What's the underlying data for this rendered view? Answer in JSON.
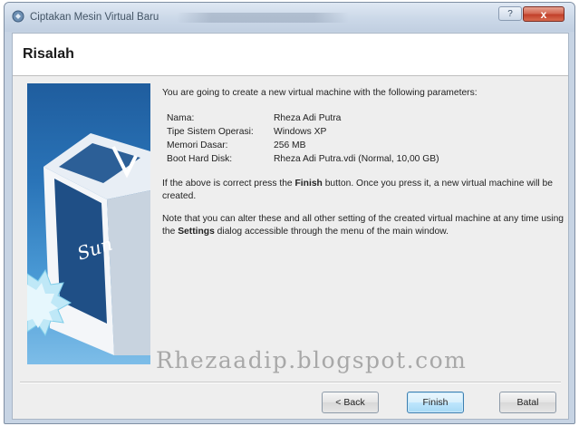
{
  "window": {
    "title": "Ciptakan Mesin Virtual Baru",
    "help_label": "?",
    "close_label": "x"
  },
  "page": {
    "title": "Risalah"
  },
  "content": {
    "intro": "You are going to create a new virtual machine with the following parameters:",
    "params": [
      {
        "key": "Nama:",
        "value": "Rheza Adi Putra"
      },
      {
        "key": "Tipe Sistem Operasi:",
        "value": "Windows XP"
      },
      {
        "key": "Memori Dasar:",
        "value": "256 MB"
      },
      {
        "key": "Boot Hard Disk:",
        "value": "Rheza Adi Putra.vdi (Normal, 10,00 GB)"
      }
    ],
    "finish_note": {
      "pre": "If the above is correct press the ",
      "bold": "Finish",
      "post": " button. Once you press it, a new virtual machine will be created."
    },
    "settings_note": {
      "pre": "Note that you can alter these and all other setting of the created virtual machine at any time using the ",
      "bold": "Settings",
      "post": " dialog accessible through the menu of the main window."
    }
  },
  "side_art": {
    "logo_text": "Sun"
  },
  "watermark": "Rhezaadip.blogspot.com",
  "buttons": {
    "back": "< Back",
    "finish": "Finish",
    "cancel": "Batal"
  },
  "colors": {
    "titlebar": "#cbd8e8",
    "close_button": "#c2412b",
    "side_art": "#2a74b8",
    "default_button": "#bee6fd"
  }
}
